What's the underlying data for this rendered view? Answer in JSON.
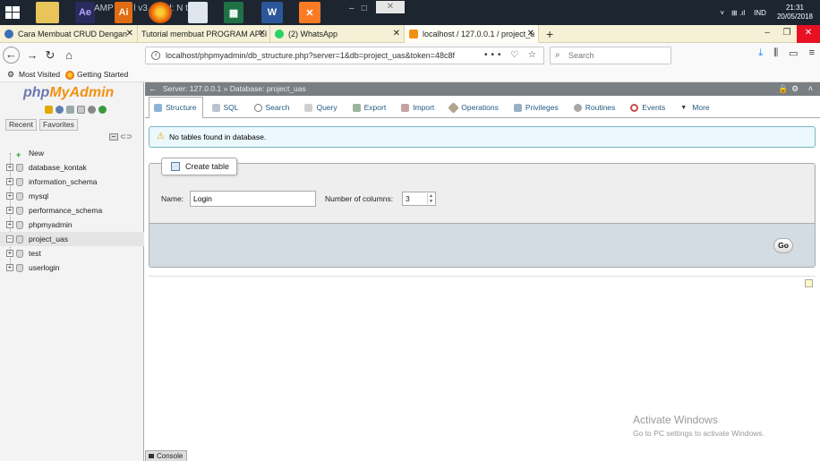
{
  "taskbar": {
    "apps": [
      {
        "name": "File Explorer",
        "icon": "folder-icon",
        "color": "#e8c45a"
      },
      {
        "name": "After Effects",
        "icon": "after-effects-icon",
        "label": "Ae",
        "color": "#2a2a5c"
      },
      {
        "name": "Illustrator",
        "icon": "illustrator-icon",
        "label": "Ai",
        "color": "#e06c14"
      },
      {
        "name": "Firefox",
        "icon": "firefox-icon",
        "color": "#e66000"
      },
      {
        "name": "Window",
        "icon": "window-icon",
        "color": "#dfe6ee"
      },
      {
        "name": "Excel",
        "icon": "excel-icon",
        "color": "#1e7145"
      },
      {
        "name": "Word",
        "icon": "word-icon",
        "color": "#2b579a"
      },
      {
        "name": "XAMPP",
        "icon": "xampp-icon",
        "color": "#fb7a24"
      }
    ],
    "ghost_text": "AMP     ntro     l v3.        Co     d: N     th 2",
    "tray": {
      "language": "IND",
      "time": "21:31",
      "date": "20/05/2018"
    }
  },
  "browser": {
    "tabs": [
      {
        "label": "Cara Membuat CRUD Dengan",
        "favicon_color": "#3b6fb6"
      },
      {
        "label": "Tutorial membuat PROGRAM APLI",
        "favicon_color": ""
      },
      {
        "label": "(2) WhatsApp",
        "favicon_color": "#25d366"
      },
      {
        "label": "localhost / 127.0.0.1 / project_u",
        "favicon_color": "#f29111",
        "active": true
      }
    ],
    "new_tab_label": "+",
    "url": "localhost/phpmyadmin/db_structure.php?server=1&db=project_uas&token=48c8f",
    "url_actions": "••• ♡ ☆",
    "search_placeholder": "Search",
    "bookmarks": [
      {
        "label": "Most Visited",
        "icon": "gear-icon"
      },
      {
        "label": "Getting Started",
        "icon": "firefox-icon"
      }
    ]
  },
  "pma": {
    "logo_php": "php",
    "logo_myadmin": "MyAdmin",
    "left_tabs": [
      "Recent",
      "Favorites"
    ],
    "databases": [
      {
        "label": "New",
        "type": "new"
      },
      {
        "label": "database_kontak"
      },
      {
        "label": "information_schema"
      },
      {
        "label": "mysql"
      },
      {
        "label": "performance_schema"
      },
      {
        "label": "phpmyadmin"
      },
      {
        "label": "project_uas",
        "selected": true
      },
      {
        "label": "test"
      },
      {
        "label": "userlogin"
      }
    ],
    "breadcrumb": {
      "server": "Server: 127.0.0.1",
      "sep": "»",
      "database": "Database: project_uas"
    },
    "tabs": [
      {
        "label": "Structure",
        "icon": "structure-icon",
        "active": true
      },
      {
        "label": "SQL",
        "icon": "sql-icon"
      },
      {
        "label": "Search",
        "icon": "search-icon"
      },
      {
        "label": "Query",
        "icon": "query-icon"
      },
      {
        "label": "Export",
        "icon": "export-icon"
      },
      {
        "label": "Import",
        "icon": "import-icon"
      },
      {
        "label": "Operations",
        "icon": "operations-icon"
      },
      {
        "label": "Privileges",
        "icon": "privileges-icon"
      },
      {
        "label": "Routines",
        "icon": "routines-icon"
      },
      {
        "label": "Events",
        "icon": "events-icon"
      },
      {
        "label": "More",
        "icon": "more-icon"
      }
    ],
    "alert": "No tables found in database.",
    "create_table": {
      "legend": "Create table",
      "name_label": "Name:",
      "name_value": "Login",
      "columns_label": "Number of columns:",
      "columns_value": "3",
      "go_label": "Go"
    },
    "console_label": "Console"
  },
  "watermark": {
    "title": "Activate Windows",
    "subtitle": "Go to PC settings to activate Windows."
  }
}
